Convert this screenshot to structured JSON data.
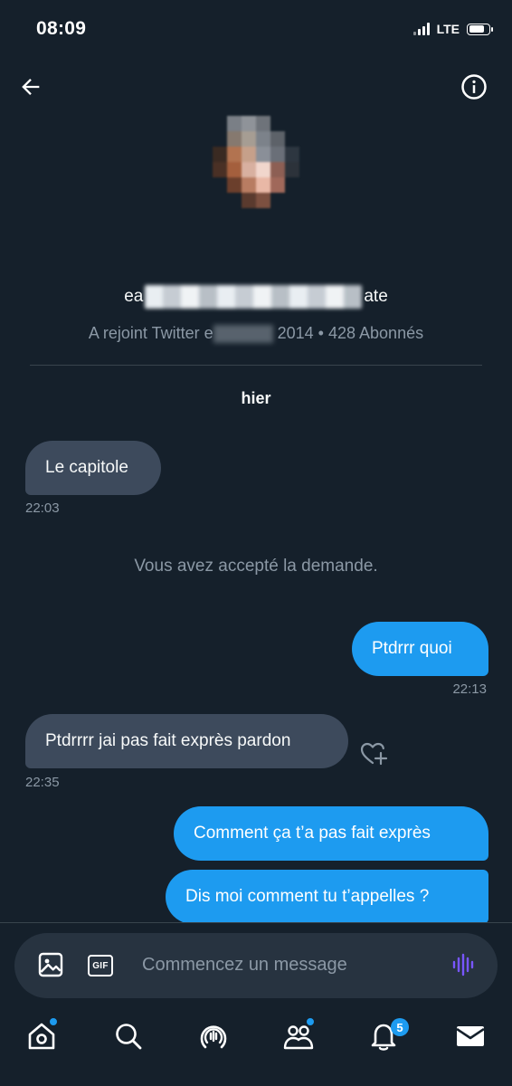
{
  "status_bar": {
    "time": "08:09",
    "network": "LTE",
    "battery_level": 0.75
  },
  "header": {
    "back_icon": "arrow-left-icon",
    "info_icon": "info-icon"
  },
  "profile": {
    "name_prefix": "ea",
    "name_suffix": "ate",
    "meta_prefix": "A rejoint Twitter e",
    "meta_suffix": "2014 • 428 Abonnés"
  },
  "conversation": {
    "day_label": "hier",
    "system_message": "Vous avez accepté la demande.",
    "messages": [
      {
        "direction": "in",
        "text": "Le capitole",
        "time": "22:03"
      },
      {
        "direction": "out",
        "text": "Ptdrrr quoi",
        "time": "22:13"
      },
      {
        "direction": "in",
        "text": "Ptdrrrr jai pas fait exprès pardon",
        "time": "22:35"
      },
      {
        "direction": "out",
        "text": "Comment ça t’a pas fait exprès",
        "time": ""
      },
      {
        "direction": "out",
        "text": "Dis moi comment tu t’appelles ?",
        "time": ""
      }
    ]
  },
  "composer": {
    "placeholder": "Commencez un message",
    "gif_label": "GIF",
    "image_icon": "image-icon",
    "voice_icon": "voice-waveform-icon",
    "voice_color": "#7856ff"
  },
  "bottom_nav": {
    "items": [
      {
        "name": "home",
        "icon": "home-icon",
        "has_dot": true
      },
      {
        "name": "search",
        "icon": "search-icon",
        "has_dot": false
      },
      {
        "name": "spaces",
        "icon": "spaces-icon",
        "has_dot": false
      },
      {
        "name": "communities",
        "icon": "communities-icon",
        "has_dot": true
      },
      {
        "name": "notifications",
        "icon": "bell-icon",
        "badge": "5"
      },
      {
        "name": "messages",
        "icon": "mail-icon",
        "has_dot": false
      }
    ]
  },
  "colors": {
    "background": "#15202b",
    "accent": "#1d9bf0",
    "incoming_bubble": "#3d4a5c",
    "secondary_text": "#8b98a5"
  }
}
